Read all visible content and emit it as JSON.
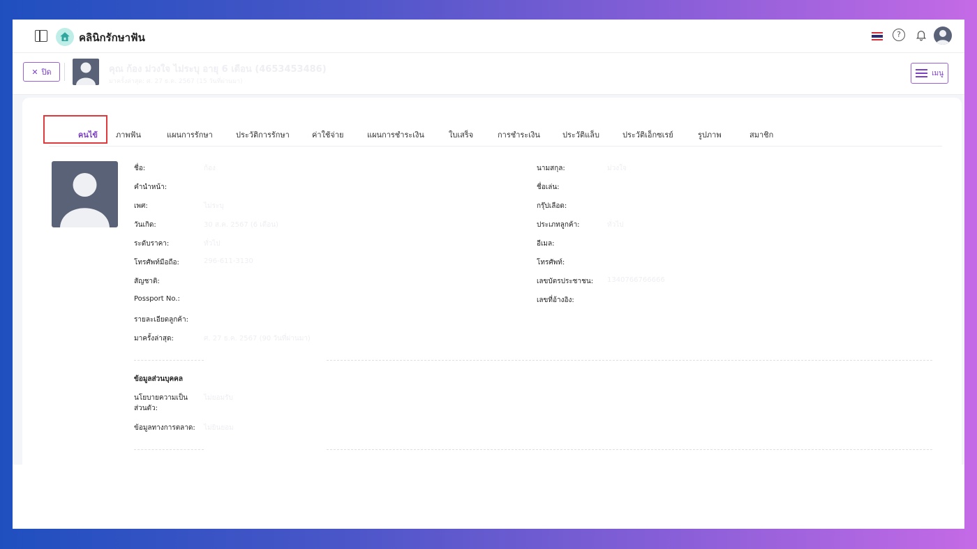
{
  "app": {
    "title": "คลินิกรักษาฟัน",
    "help_symbol": "?"
  },
  "patient_header": {
    "close_label": "ปิด",
    "name": "คุณ ก้อง ม่วงใจ ไม่ระบุ อายุ 6 เดือน (4653453486)",
    "subtitle": "มาครั้งล่าสุด: ศ. 27 ธ.ค. 2567 (15 วันที่ผ่านมา)",
    "menu_label": "เมนู"
  },
  "tabs": [
    {
      "label": "คนไข้",
      "active": true
    },
    {
      "label": "ภาพฟัน"
    },
    {
      "label": "แผนการรักษา"
    },
    {
      "label": "ประวัติการรักษา"
    },
    {
      "label": "ค่าใช้จ่าย"
    },
    {
      "label": "แผนการชำระเงิน"
    },
    {
      "label": "ใบเสร็จ"
    },
    {
      "label": "การชำระเงิน"
    },
    {
      "label": "ประวัติแล็บ"
    },
    {
      "label": "ประวัติเอ็กซเรย์"
    },
    {
      "label": "รูปภาพ"
    },
    {
      "label": "สมาชิก"
    }
  ],
  "fields_left": [
    {
      "label": "ชื่อ:",
      "value": "ก้อง"
    },
    {
      "label": "คำนำหน้า:",
      "value": ""
    },
    {
      "label": "เพศ:",
      "value": "ไม่ระบุ"
    },
    {
      "label": "วันเกิด:",
      "value": "30 ส.ค. 2567 (6 เดือน)"
    },
    {
      "label": "ระดับราคา:",
      "value": "ทั่วไป"
    },
    {
      "label": "โทรศัพท์มือถือ:",
      "value": "296-611-3130"
    },
    {
      "label": "สัญชาติ:",
      "value": ""
    },
    {
      "label": "Possport No.:",
      "value": ""
    },
    {
      "label": "รายละเอียดลูกค้า:",
      "value": ""
    },
    {
      "label": "มาครั้งล่าสุด:",
      "value": "ศ. 27 ธ.ค. 2567 (90 วันที่ผ่านมา)"
    }
  ],
  "fields_right": [
    {
      "label": "นามสกุล:",
      "value": "ม่วงใจ"
    },
    {
      "label": "ชื่อเล่น:",
      "value": ""
    },
    {
      "label": "กรุ๊ปเลือด:",
      "value": ""
    },
    {
      "label": "ประเภทลูกค้า:",
      "value": "ทั่วไป"
    },
    {
      "label": "อีเมล:",
      "value": ""
    },
    {
      "label": "โทรศัพท์:",
      "value": ""
    },
    {
      "label": "เลขบัตรประชาชน:",
      "value": "1340766766666"
    },
    {
      "label": "เลขที่อ้างอิง:",
      "value": ""
    }
  ],
  "personal_section": {
    "title": "ข้อมูลส่วนบุคคล",
    "privacy_label_line1": "นโยบายความเป็น",
    "privacy_label_line2": "ส่วนตัว:",
    "privacy_value": "ไม่ยอมรับ",
    "marketing_label": "ข้อมูลทางการตลาด:",
    "marketing_value": "ไม่ยินยอม"
  },
  "colors": {
    "accent": "#7b3fc6",
    "highlight_box": "#e0393c",
    "avatar_bg": "#5a6277"
  }
}
